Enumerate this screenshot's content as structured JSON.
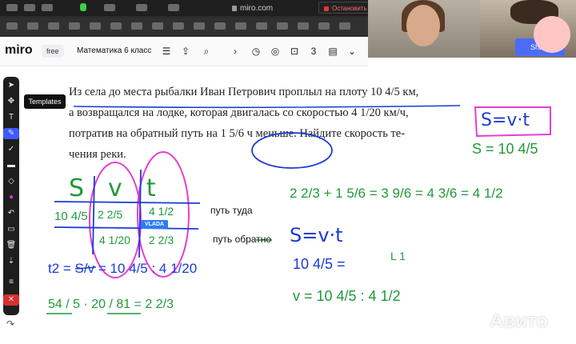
{
  "browser": {
    "url": "miro.com",
    "share_banner": "Остановить совместное использование"
  },
  "miro": {
    "logo": "miro",
    "plan": "free",
    "board_name": "Математика 6 класс",
    "tooltip": "Templates",
    "share_button": "Share"
  },
  "problem": {
    "line1": "Из села до места рыбалки Иван Петрович проплыл на плоту 10 4/5 км,",
    "line2": "а возвращался на лодке, которая двигалась со скоростью 4 1/20 км/ч,",
    "line3": "потратив на обратный путь на 1 5/6 ч меньше. Найдите скорость те-",
    "line4": "чения реки."
  },
  "annotations": {
    "path_there": "путь туда",
    "path_back": "путь обратно",
    "cursor_label": "VLADA",
    "formula1": "S=v·t",
    "formula1_b": "S = 10 4/5",
    "formula2": "S=v·t",
    "table_head": [
      "S",
      "v",
      "t"
    ],
    "row1": [
      "10 4/5",
      "2 2/5",
      "4 1/2"
    ],
    "row2": [
      "10 4/5",
      "4 1/20",
      "2 2/3"
    ],
    "calc1": "2 2/3 + 1 5/6 = 3 9/6 = 4 3/6 = 4 1/2",
    "calc2": "10 4/5 =",
    "calc3": "v = 10 4/5 : 4 1/2",
    "calc4": "t2 = S/v = 10 4/5 : 4 1/20",
    "calc5": "54 / 5 · 20 / 81 = 2 2/3",
    "note": "L 1"
  },
  "watermark": "Авито",
  "colors": {
    "blue_pen": "#1a3bd6",
    "green_pen": "#1f9a3a",
    "pink_pen": "#e63fd0",
    "toolbar_dark": "#1e1e1e",
    "accent": "#4a6cf7"
  }
}
